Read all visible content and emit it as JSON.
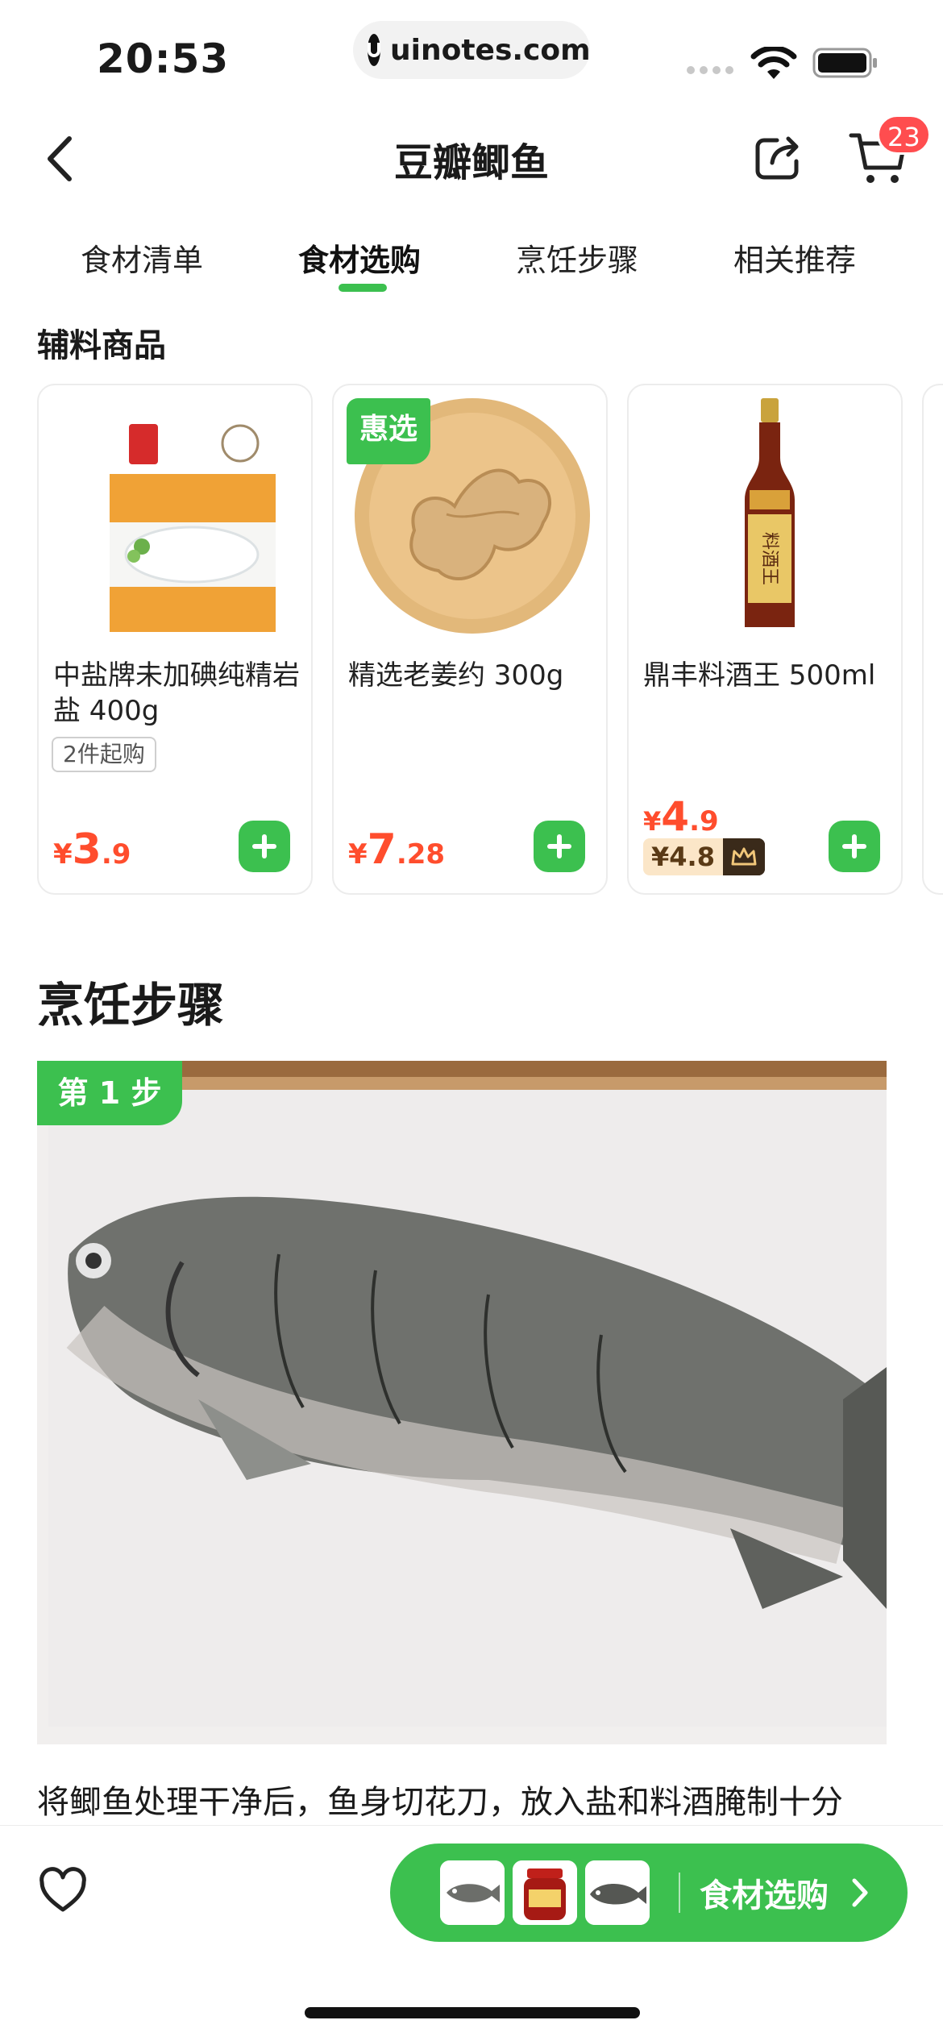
{
  "status_bar": {
    "time": "20:53",
    "url": "uinotes.com"
  },
  "nav": {
    "title": "豆瓣鲫鱼",
    "cart_count": "23"
  },
  "tabs": [
    {
      "label": "食材清单"
    },
    {
      "label": "食材选购",
      "active": true
    },
    {
      "label": "烹饪步骤"
    },
    {
      "label": "相关推荐"
    }
  ],
  "section_title": "辅料商品",
  "products": [
    {
      "name": "中盐牌未加碘纯精岩盐 400g",
      "min_buy": "2件起购",
      "price_yen": "¥",
      "price_int": "3",
      "price_dec": ".9",
      "icon": "salt-package-image"
    },
    {
      "name": "精选老姜约 300g",
      "badge": "惠选",
      "price_yen": "¥",
      "price_int": "7",
      "price_dec": ".28",
      "icon": "ginger-image"
    },
    {
      "name": "鼎丰料酒王 500ml",
      "price_yen": "¥",
      "price_int": "4",
      "price_dec": ".9",
      "vip_price": "¥4.8",
      "icon": "cooking-wine-bottle-image",
      "label_text": "料酒王"
    }
  ],
  "steps": {
    "title": "烹饪步骤",
    "step_label": "第 1 步",
    "step_text": "将鲫鱼处理干净后，鱼身切花刀，放入盐和料酒腌制十分"
  },
  "bottom_bar": {
    "shop_label": "食材选购"
  },
  "colors": {
    "accent": "#3cc04f",
    "price": "#ff4d2d",
    "badge": "#ff4d4f"
  }
}
